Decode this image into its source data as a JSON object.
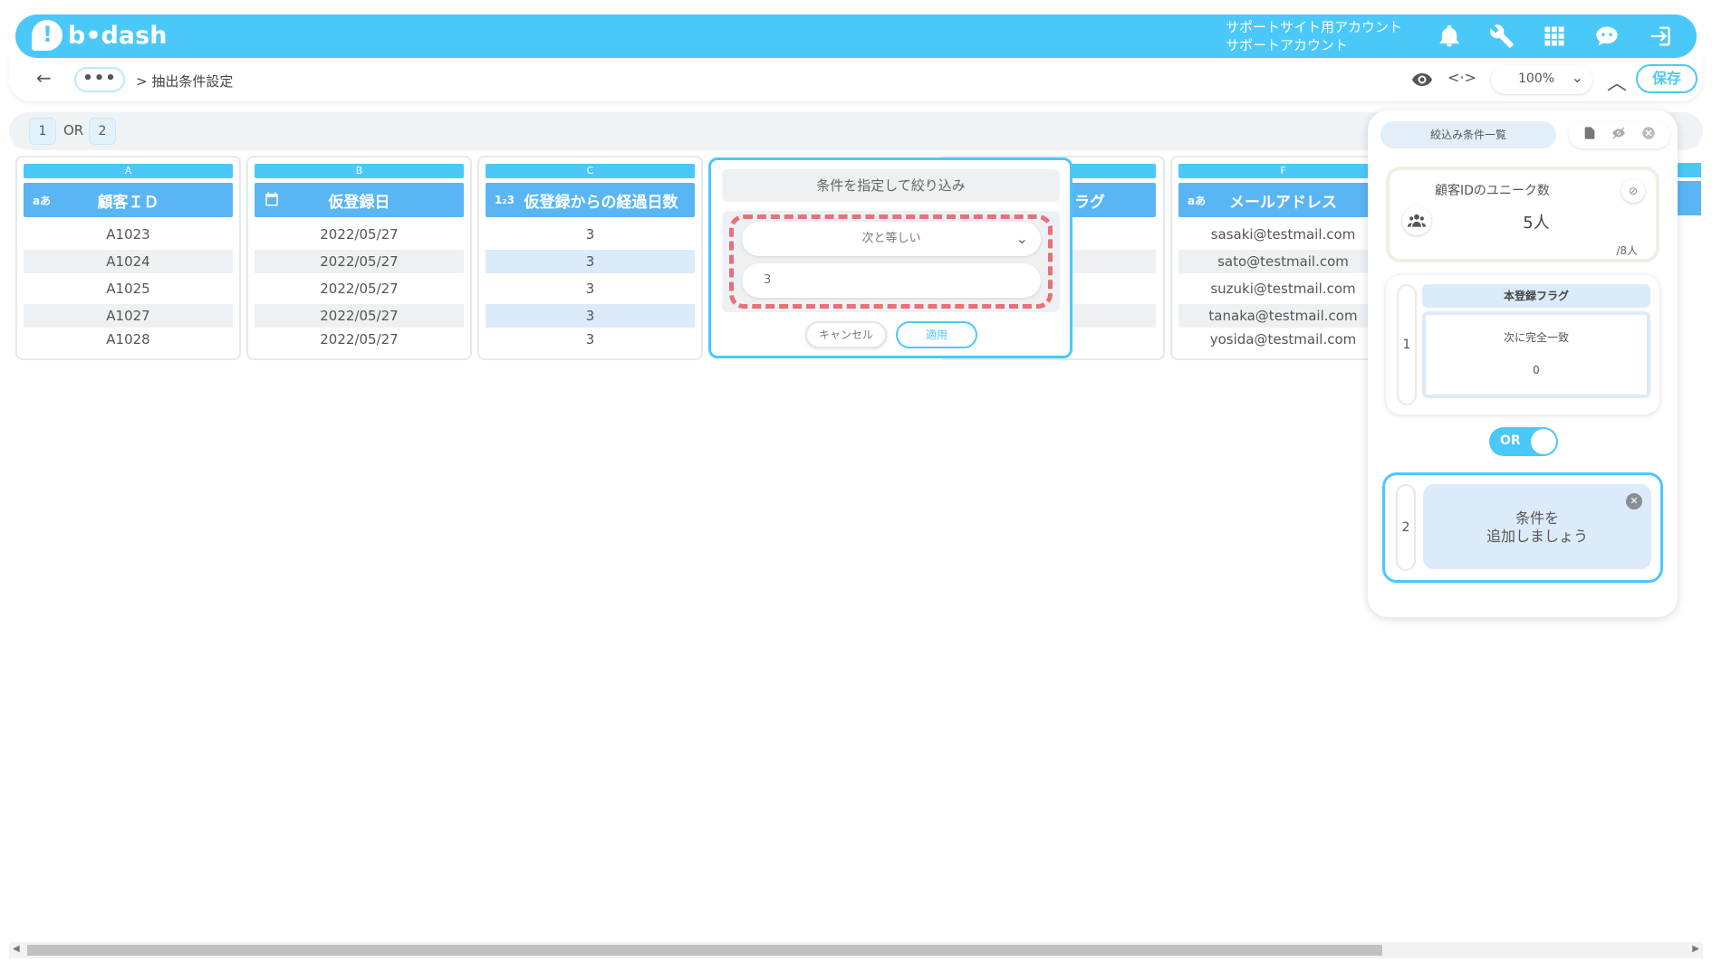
{
  "header": {
    "logo_text": "b•dash",
    "account_line1": "サポートサイト用アカウント",
    "account_line2": "サポートアカウント"
  },
  "toolbar": {
    "dots_label": "•••",
    "breadcrumb": "> 抽出条件設定",
    "zoom_value": "100%",
    "save_label": "保存",
    "code_label": "<·>"
  },
  "group_bar": {
    "chip1": "1",
    "or_label": "OR",
    "chip2": "2"
  },
  "columns": [
    {
      "letter": "A",
      "type_icon": "aあ",
      "header": "顧客ＩＤ",
      "cells": [
        "A1023",
        "A1024",
        "A1025",
        "A1027",
        "A1028"
      ]
    },
    {
      "letter": "B",
      "type_icon": "calendar",
      "header": "仮登録日",
      "cells": [
        "2022/05/27",
        "2022/05/27",
        "2022/05/27",
        "2022/05/27",
        "2022/05/27"
      ]
    },
    {
      "letter": "C",
      "type_icon": "1₂3",
      "header": "仮登録からの経過日数",
      "cells": [
        "3",
        "3",
        "3",
        "3",
        "3"
      ]
    },
    {
      "letter": "",
      "type_icon": "",
      "header": "ラグ",
      "cells": []
    },
    {
      "letter": "F",
      "type_icon": "aあ",
      "header": "メールアドレス",
      "cells": [
        "sasaki@testmail.com",
        "sato@testmail.com",
        "suzuki@testmail.com",
        "tanaka@testmail.com",
        "yosida@testmail.com"
      ]
    }
  ],
  "filter_popup": {
    "title": "条件を指定して絞り込み",
    "operator": "次と等しい",
    "value": "3",
    "cancel_label": "キャンセル",
    "apply_label": "適用"
  },
  "right_panel": {
    "tab_label": "絞込み条件一覧",
    "stat": {
      "title": "顧客IDのユニーク数",
      "value": "5人",
      "total": "/8人"
    },
    "condition1": {
      "number": "1",
      "field": "本登録フラグ",
      "operator": "次に完全一致",
      "value": "0"
    },
    "toggle_label": "OR",
    "condition2": {
      "number": "2",
      "text_line1": "条件を",
      "text_line2": "追加しましょう"
    }
  },
  "colors": {
    "accent": "#4bc8fa",
    "header_blue": "#5ab5f4",
    "dash_red": "#e8707a"
  }
}
